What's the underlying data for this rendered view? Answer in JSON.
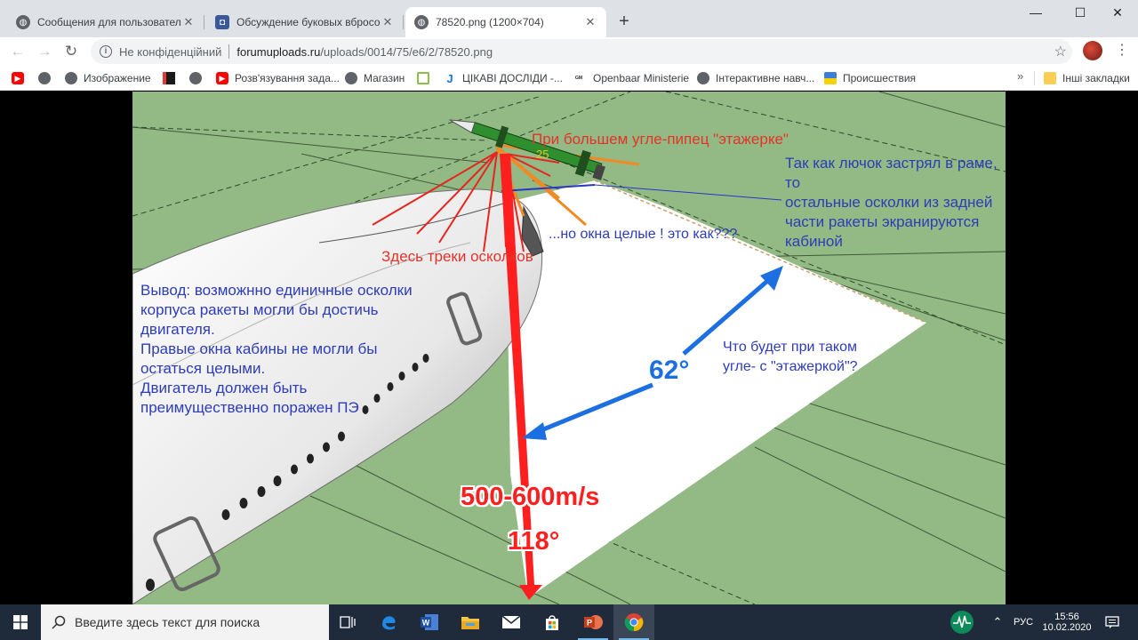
{
  "browser": {
    "tabs": [
      {
        "title": "Сообщения для пользователей",
        "icon": "globe-icon",
        "active": false
      },
      {
        "title": "Обсуждение буковых вбросов",
        "icon": "forum-icon",
        "active": false
      },
      {
        "title": "78520.png (1200×704)",
        "icon": "globe-icon",
        "active": true
      }
    ],
    "new_tab_label": "+",
    "window_controls": {
      "minimize": "—",
      "maximize": "☐",
      "close": "✕"
    },
    "address": {
      "security_label": "Не конфіденційний",
      "host": "forumuploads.ru",
      "path": "/uploads/0014/75/e6/2/78520.png"
    },
    "bookmarks": [
      {
        "label": "",
        "icon": "youtube-icon"
      },
      {
        "label": "",
        "icon": "globe-icon"
      },
      {
        "label": "Изображение",
        "icon": "globe-icon"
      },
      {
        "label": "",
        "icon": "red-bar-icon"
      },
      {
        "label": "",
        "icon": "globe-icon"
      },
      {
        "label": "Розв'язування зада...",
        "icon": "youtube-icon"
      },
      {
        "label": "Магазин",
        "icon": "globe-icon"
      },
      {
        "label": "",
        "icon": "green-square-icon"
      },
      {
        "label": "ЦІКАВІ ДОСЛІДИ -...",
        "icon": "j-icon"
      },
      {
        "label": "Openbaar Ministerie",
        "icon": "om-icon"
      },
      {
        "label": "Інтерактивне навч...",
        "icon": "globe-icon"
      },
      {
        "label": "Происшествия",
        "icon": "ukraine-flag-icon"
      }
    ],
    "bookmarks_more": "»",
    "other_bookmarks": "Інші закладки"
  },
  "figure": {
    "annotations": {
      "etazherka": "При большем угле-пипец \"этажерке\"",
      "angle_small": "25",
      "hatch": "Так как лючок застрял в раме, то\nостальные осколки из задней\nчасти ракеты экранируются\nкабиной",
      "windows": "...но окна целые ! это как???",
      "tracks": "Здесь треки осколков",
      "conclusion": "Вывод: возможнно единичные осколки\nкорпуса ракеты могли бы достичь\nдвигателя.\n  Правые окна кабины не могли бы\nостаться целыми.\n Двигатель должен быть\nпреимущественно поражен ПЭ",
      "question": "Что будет при  таком\nугле- с \"этажеркой\"?",
      "angle_62": "62°",
      "speed": "500-600m/s",
      "angle_118": "118°"
    },
    "colors": {
      "ground": "#93b984",
      "plane": "#f2f2f2",
      "red": "#ff1f1f",
      "blue": "#1b6fe0",
      "orange": "#f08a24"
    }
  },
  "taskbar": {
    "search_placeholder": "Введите здесь текст для поиска",
    "apps": [
      "task-view-icon",
      "edge-icon",
      "word-icon",
      "file-explorer-icon",
      "mail-icon",
      "store-icon",
      "powerpoint-icon",
      "chrome-icon"
    ],
    "language": "РУС",
    "time": "15:56",
    "date": "10.02.2020"
  }
}
